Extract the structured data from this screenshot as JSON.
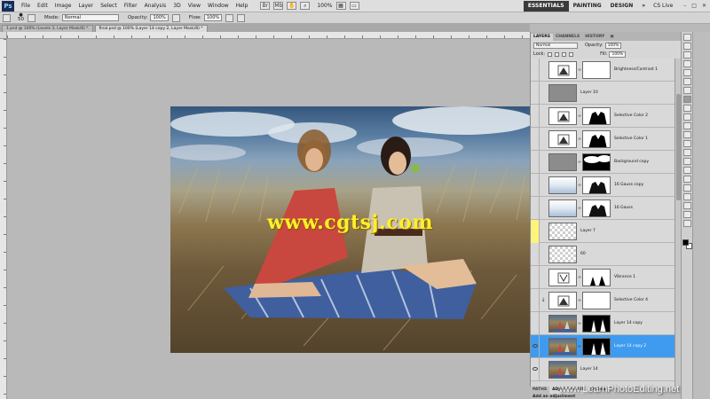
{
  "app": {
    "logo": "Ps"
  },
  "menu": [
    "File",
    "Edit",
    "Image",
    "Layer",
    "Select",
    "Filter",
    "Analysis",
    "3D",
    "View",
    "Window",
    "Help"
  ],
  "menubar": {
    "zoom": "100%",
    "workspaces": [
      "ESSENTIALS",
      "PAINTING",
      "DESIGN"
    ],
    "more": "»",
    "cslive": "CS Live"
  },
  "options": {
    "brush_size": "50",
    "mode_label": "Mode:",
    "mode_value": "Normal",
    "opacity_label": "Opacity:",
    "opacity_value": "100%",
    "flow_label": "Flow:",
    "flow_value": "100%"
  },
  "tabs": [
    "1.psd @ 100% (Levels 3, Layer Mask/8) *",
    "final.psd @ 100% (Layer 14 copy 2, Layer Mask/8) *"
  ],
  "canvas": {
    "watermark": "www.cgtsj.com"
  },
  "panel": {
    "tabs": [
      "LAYERS",
      "CHANNELS",
      "HISTORY"
    ],
    "blend_mode": "Normal",
    "opacity_label": "Opacity:",
    "opacity_value": "100%",
    "lock_label": "Lock:",
    "fill_label": "Fill:",
    "fill_value": "100%"
  },
  "layers": [
    {
      "name": "Brightness/Contrast 1",
      "type": "adjustment",
      "has_mask": true,
      "mask": "white"
    },
    {
      "name": "Layer 10",
      "type": "gray",
      "has_mask": false
    },
    {
      "name": "Selective Color 2",
      "type": "adjustment",
      "has_mask": true,
      "mask": "silhouette"
    },
    {
      "name": "Selective Color 1",
      "type": "adjustment",
      "has_mask": true,
      "mask": "silhouette"
    },
    {
      "name": "Background copy",
      "type": "gray",
      "has_mask": true,
      "mask": "clouds"
    },
    {
      "name": "16 Gauss copy",
      "type": "sky",
      "has_mask": true,
      "mask": "silhouette-white"
    },
    {
      "name": "16 Gauss",
      "type": "sky",
      "has_mask": true,
      "mask": "silhouette-white"
    },
    {
      "name": "Layer 7",
      "type": "transparent",
      "has_mask": false,
      "eye": "yellow"
    },
    {
      "name": "60",
      "type": "transparent",
      "has_mask": false
    },
    {
      "name": "Vibrance 1",
      "type": "vibrance",
      "has_mask": true,
      "mask": "figures"
    },
    {
      "name": "Selective Color 4",
      "type": "adjustment",
      "has_mask": true,
      "mask": "white",
      "clipped": true
    },
    {
      "name": "Layer 14 copy",
      "type": "photo",
      "has_mask": true,
      "mask": "dark-figures"
    },
    {
      "name": "Layer 14 copy 2",
      "type": "photo",
      "has_mask": true,
      "mask": "dark-figures",
      "selected": true,
      "eye": "on"
    },
    {
      "name": "Layer 14",
      "type": "photo",
      "has_mask": false,
      "eye": "on"
    }
  ],
  "bottom_tabs": [
    "PATHS",
    "ADJUSTMENTS",
    "MASKS"
  ],
  "adjustments_hint": "Add an adjustment",
  "site_watermark": "www.LearnPhotoEditing.net"
}
